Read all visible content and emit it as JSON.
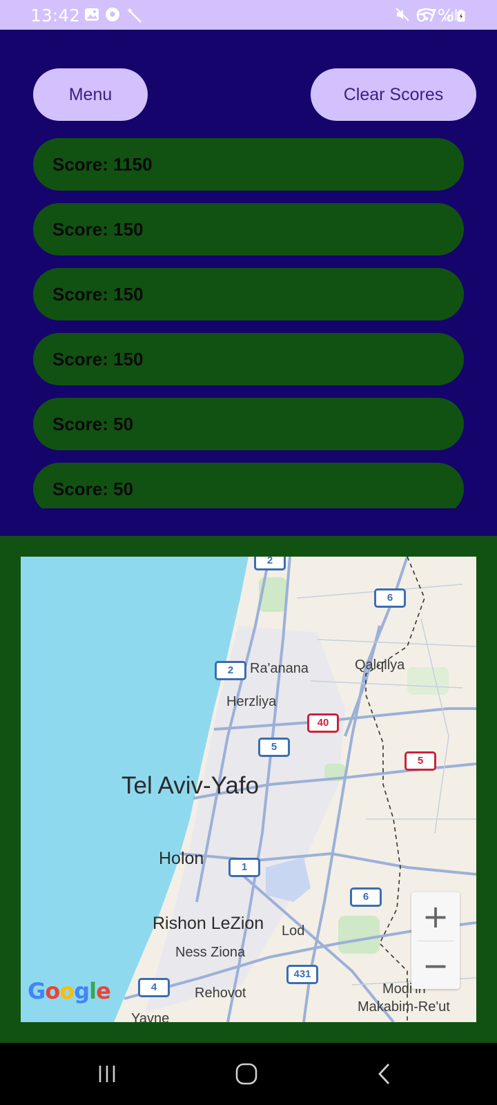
{
  "status_bar": {
    "time": "13:42",
    "battery": "67%"
  },
  "buttons": {
    "menu": "Menu",
    "clear_scores": "Clear Scores"
  },
  "scores": [
    "Score: 1150",
    "Score: 150",
    "Score: 150",
    "Score: 150",
    "Score: 50",
    "Score: 50"
  ],
  "map": {
    "labels": {
      "raanana": "Ra'anana",
      "qalqilya": "Qalqilya",
      "herzliya": "Herzliya",
      "tel_aviv": "Tel Aviv-Yafo",
      "holon": "Holon",
      "rishon": "Rishon LeZion",
      "lod": "Lod",
      "ness_ziona": "Ness Ziona",
      "rehovot": "Rehovot",
      "modiin": "Modi'in",
      "makabim": "Makabim-Re'ut",
      "yavne": "Yavne"
    },
    "shields": {
      "s2_top": "2",
      "s6_top": "6",
      "s2": "2",
      "s40": "40",
      "s5": "5",
      "s5_red": "5",
      "s1": "1",
      "s6": "6",
      "s431": "431",
      "s4": "4"
    },
    "zoom_in": "+",
    "zoom_out": "−",
    "google_logo": "Google"
  },
  "colors": {
    "primary_bg": "#15046b",
    "button_bg": "#d2c1fc",
    "button_text": "#3a1f84",
    "score_bg": "#115212",
    "sea": "#8fd9ee"
  }
}
